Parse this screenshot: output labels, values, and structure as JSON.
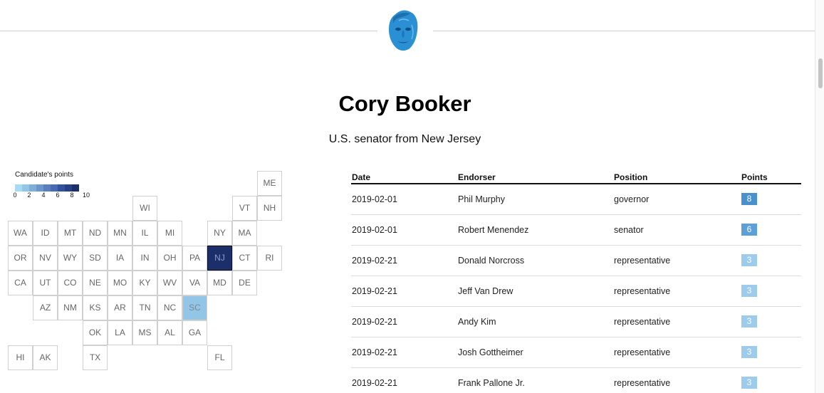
{
  "page": {
    "title": "Cory Booker",
    "subtitle": "U.S. senator from New Jersey"
  },
  "icons": {
    "avatar": "candidate-portrait"
  },
  "legend": {
    "title": "Candidate's points",
    "ticks": [
      "0",
      "2",
      "4",
      "6",
      "8",
      "10"
    ],
    "colors": [
      "#a6dcf3",
      "#93c5e6",
      "#7faed9",
      "#6c97cc",
      "#5880bf",
      "#4569b2",
      "#33529d",
      "#263f85",
      "#1c2f6b"
    ]
  },
  "map": {
    "states": [
      {
        "abbr": "ME",
        "col": 10,
        "row": 0,
        "points": 0
      },
      {
        "abbr": "WI",
        "col": 5,
        "row": 1,
        "points": 0
      },
      {
        "abbr": "VT",
        "col": 9,
        "row": 1,
        "points": 0
      },
      {
        "abbr": "NH",
        "col": 10,
        "row": 1,
        "points": 0
      },
      {
        "abbr": "WA",
        "col": 0,
        "row": 2,
        "points": 0
      },
      {
        "abbr": "ID",
        "col": 1,
        "row": 2,
        "points": 0
      },
      {
        "abbr": "MT",
        "col": 2,
        "row": 2,
        "points": 0
      },
      {
        "abbr": "ND",
        "col": 3,
        "row": 2,
        "points": 0
      },
      {
        "abbr": "MN",
        "col": 4,
        "row": 2,
        "points": 0
      },
      {
        "abbr": "IL",
        "col": 5,
        "row": 2,
        "points": 0
      },
      {
        "abbr": "MI",
        "col": 6,
        "row": 2,
        "points": 0
      },
      {
        "abbr": "NY",
        "col": 8,
        "row": 2,
        "points": 0
      },
      {
        "abbr": "MA",
        "col": 9,
        "row": 2,
        "points": 0
      },
      {
        "abbr": "OR",
        "col": 0,
        "row": 3,
        "points": 0
      },
      {
        "abbr": "NV",
        "col": 1,
        "row": 3,
        "points": 0
      },
      {
        "abbr": "WY",
        "col": 2,
        "row": 3,
        "points": 0
      },
      {
        "abbr": "SD",
        "col": 3,
        "row": 3,
        "points": 0
      },
      {
        "abbr": "IA",
        "col": 4,
        "row": 3,
        "points": 0
      },
      {
        "abbr": "IN",
        "col": 5,
        "row": 3,
        "points": 0
      },
      {
        "abbr": "OH",
        "col": 6,
        "row": 3,
        "points": 0
      },
      {
        "abbr": "PA",
        "col": 7,
        "row": 3,
        "points": 0
      },
      {
        "abbr": "NJ",
        "col": 8,
        "row": 3,
        "points": 10
      },
      {
        "abbr": "CT",
        "col": 9,
        "row": 3,
        "points": 0
      },
      {
        "abbr": "RI",
        "col": 10,
        "row": 3,
        "points": 0
      },
      {
        "abbr": "CA",
        "col": 0,
        "row": 4,
        "points": 0
      },
      {
        "abbr": "UT",
        "col": 1,
        "row": 4,
        "points": 0
      },
      {
        "abbr": "CO",
        "col": 2,
        "row": 4,
        "points": 0
      },
      {
        "abbr": "NE",
        "col": 3,
        "row": 4,
        "points": 0
      },
      {
        "abbr": "MO",
        "col": 4,
        "row": 4,
        "points": 0
      },
      {
        "abbr": "KY",
        "col": 5,
        "row": 4,
        "points": 0
      },
      {
        "abbr": "WV",
        "col": 6,
        "row": 4,
        "points": 0
      },
      {
        "abbr": "VA",
        "col": 7,
        "row": 4,
        "points": 0
      },
      {
        "abbr": "MD",
        "col": 8,
        "row": 4,
        "points": 0
      },
      {
        "abbr": "DE",
        "col": 9,
        "row": 4,
        "points": 0
      },
      {
        "abbr": "AZ",
        "col": 1,
        "row": 5,
        "points": 0
      },
      {
        "abbr": "NM",
        "col": 2,
        "row": 5,
        "points": 0
      },
      {
        "abbr": "KS",
        "col": 3,
        "row": 5,
        "points": 0
      },
      {
        "abbr": "AR",
        "col": 4,
        "row": 5,
        "points": 0
      },
      {
        "abbr": "TN",
        "col": 5,
        "row": 5,
        "points": 0
      },
      {
        "abbr": "NC",
        "col": 6,
        "row": 5,
        "points": 0
      },
      {
        "abbr": "SC",
        "col": 7,
        "row": 5,
        "points": 1
      },
      {
        "abbr": "OK",
        "col": 3,
        "row": 6,
        "points": 0
      },
      {
        "abbr": "LA",
        "col": 4,
        "row": 6,
        "points": 0
      },
      {
        "abbr": "MS",
        "col": 5,
        "row": 6,
        "points": 0
      },
      {
        "abbr": "AL",
        "col": 6,
        "row": 6,
        "points": 0
      },
      {
        "abbr": "GA",
        "col": 7,
        "row": 6,
        "points": 0
      },
      {
        "abbr": "HI",
        "col": 0,
        "row": 7,
        "points": 0
      },
      {
        "abbr": "AK",
        "col": 1,
        "row": 7,
        "points": 0
      },
      {
        "abbr": "TX",
        "col": 3,
        "row": 7,
        "points": 0
      },
      {
        "abbr": "FL",
        "col": 8,
        "row": 7,
        "points": 0
      }
    ]
  },
  "table": {
    "headers": {
      "date": "Date",
      "endorser": "Endorser",
      "position": "Position",
      "points": "Points"
    },
    "rows": [
      {
        "date": "2019-02-01",
        "endorser": "Phil Murphy",
        "position": "governor",
        "points": "8",
        "color": "#4a90cf"
      },
      {
        "date": "2019-02-01",
        "endorser": "Robert Menendez",
        "position": "senator",
        "points": "6",
        "color": "#5c9fd9"
      },
      {
        "date": "2019-02-21",
        "endorser": "Donald Norcross",
        "position": "representative",
        "points": "3",
        "color": "#9ccbec"
      },
      {
        "date": "2019-02-21",
        "endorser": "Jeff Van Drew",
        "position": "representative",
        "points": "3",
        "color": "#9ccbec"
      },
      {
        "date": "2019-02-21",
        "endorser": "Andy Kim",
        "position": "representative",
        "points": "3",
        "color": "#9ccbec"
      },
      {
        "date": "2019-02-21",
        "endorser": "Josh Gottheimer",
        "position": "representative",
        "points": "3",
        "color": "#9ccbec"
      },
      {
        "date": "2019-02-21",
        "endorser": "Frank Pallone Jr.",
        "position": "representative",
        "points": "3",
        "color": "#9ccbec"
      }
    ]
  }
}
